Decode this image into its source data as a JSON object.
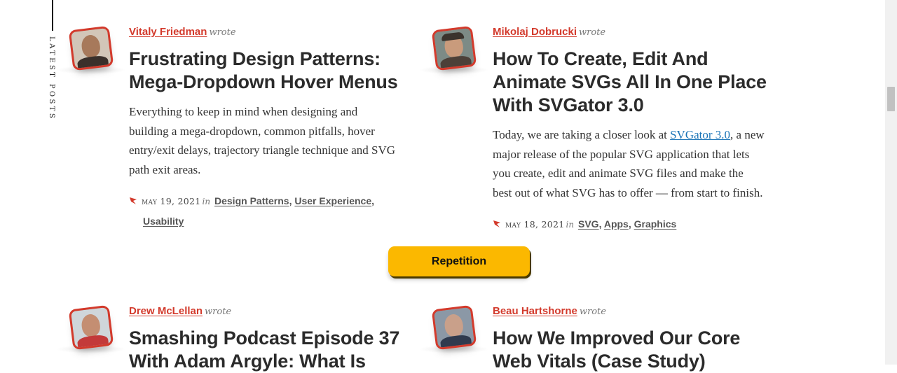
{
  "sidebar": {
    "label": "Latest Posts"
  },
  "button": {
    "label": "Repetition"
  },
  "wrote_text": "wrote",
  "in_text": "in",
  "posts": [
    {
      "author": "Vitaly Friedman",
      "title_lines": [
        "Frustrating Design Patterns:",
        "Mega-Dropdown Hover Menus"
      ],
      "excerpt_lines": [
        "Everything to keep in mind when designing and",
        "building a mega-dropdown, common pitfalls, hover",
        "entry/exit delays, trajectory triangle technique and SVG",
        "path exit areas."
      ],
      "date": "May 19, 2021",
      "tags": [
        "Design Patterns",
        "User Experience",
        "Usability"
      ]
    },
    {
      "author": "Mikolaj Dobrucki",
      "title_lines": [
        "How To Create, Edit And",
        "Animate SVGs All In One Place",
        "With SVGator 3.0"
      ],
      "excerpt_pre": "Today, we are taking a closer look at ",
      "excerpt_link": "SVGator 3.0",
      "excerpt_post_lines": [
        ", a new",
        "major release of the popular SVG application that lets",
        "you create, edit and animate SVG files and make the",
        "best out of what SVG has to offer — from start to finish."
      ],
      "date": "May 18, 2021",
      "tags": [
        "SVG",
        "Apps",
        "Graphics"
      ]
    },
    {
      "author": "Drew McLellan",
      "title_lines": [
        "Smashing Podcast Episode 37",
        "With Adam Argyle: What Is"
      ]
    },
    {
      "author": "Beau Hartshorne",
      "title_lines": [
        "How We Improved Our Core",
        "Web Vitals (Case Study)"
      ]
    }
  ],
  "colors": {
    "accent": "#d33a2c",
    "button": "#fbb800",
    "link": "#1b74b7"
  },
  "icons": {
    "flag": "red-flag-icon"
  }
}
